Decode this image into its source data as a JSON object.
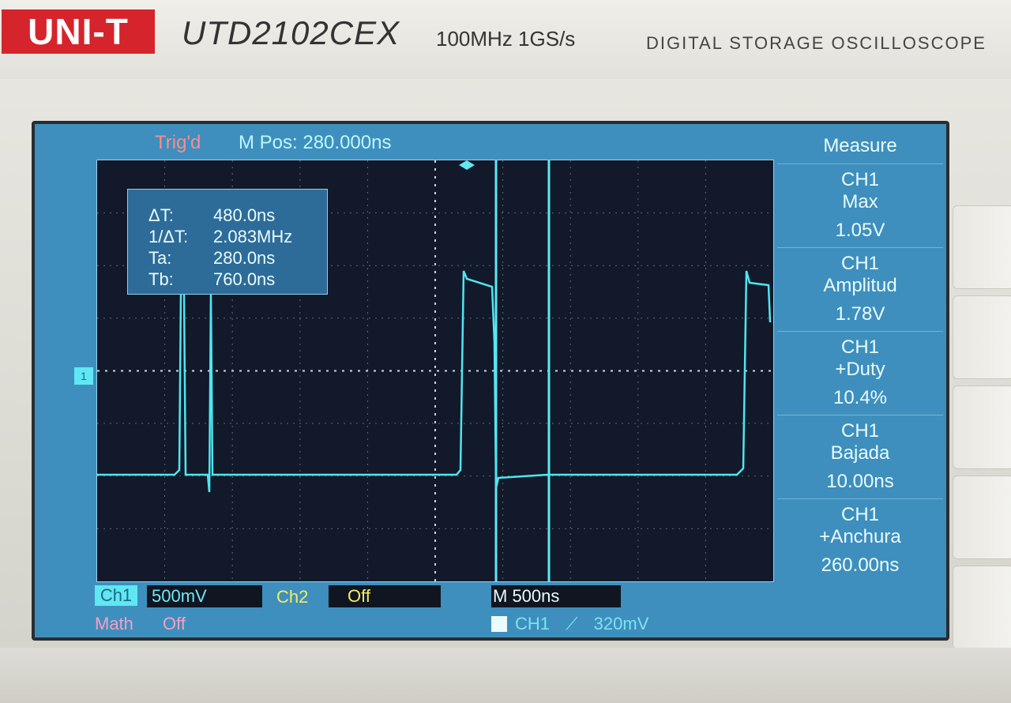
{
  "device": {
    "brand": "UNI-T",
    "model": "UTD2102CEX",
    "spec": "100MHz  1GS/s",
    "type": "DIGITAL STORAGE OSCILLOSCOPE"
  },
  "status": {
    "trigger_state": "Trig'd",
    "m_pos": "M Pos: 280.000ns"
  },
  "cursors": [
    {
      "label": "ΔT:",
      "value": "480.0ns"
    },
    {
      "label": "1/ΔT:",
      "value": "2.083MHz"
    },
    {
      "label": "Ta:",
      "value": "280.0ns"
    },
    {
      "label": "Tb:",
      "value": "760.0ns"
    }
  ],
  "measure": {
    "title": "Measure",
    "items": [
      {
        "source": "CH1",
        "name": "Max",
        "value": "1.05V"
      },
      {
        "source": "CH1",
        "name": "Amplitud",
        "value": "1.78V"
      },
      {
        "source": "CH1",
        "name": "+Duty",
        "value": "10.4%"
      },
      {
        "source": "CH1",
        "name": "Bajada",
        "value": "10.00ns"
      },
      {
        "source": "CH1",
        "name": "+Anchura",
        "value": "260.00ns"
      }
    ]
  },
  "channels": {
    "ch1_label": "Ch1",
    "ch1_scale": "500mV",
    "ch2_label": "Ch2",
    "ch2_state": "Off",
    "math_label": "Math",
    "math_state": "Off",
    "ch1_marker": "1"
  },
  "timebase": "M 500ns",
  "trigger": {
    "source": "CH1",
    "slope_icon": "rising-edge-icon",
    "level": "320mV"
  },
  "colors": {
    "screen_bg": "#3e8fbd",
    "grid_bg": "#12192a",
    "trace": "#4ee6f0",
    "ch2": "#f5ec5e",
    "math": "#f2a0c8",
    "brand": "#d6242c"
  }
}
